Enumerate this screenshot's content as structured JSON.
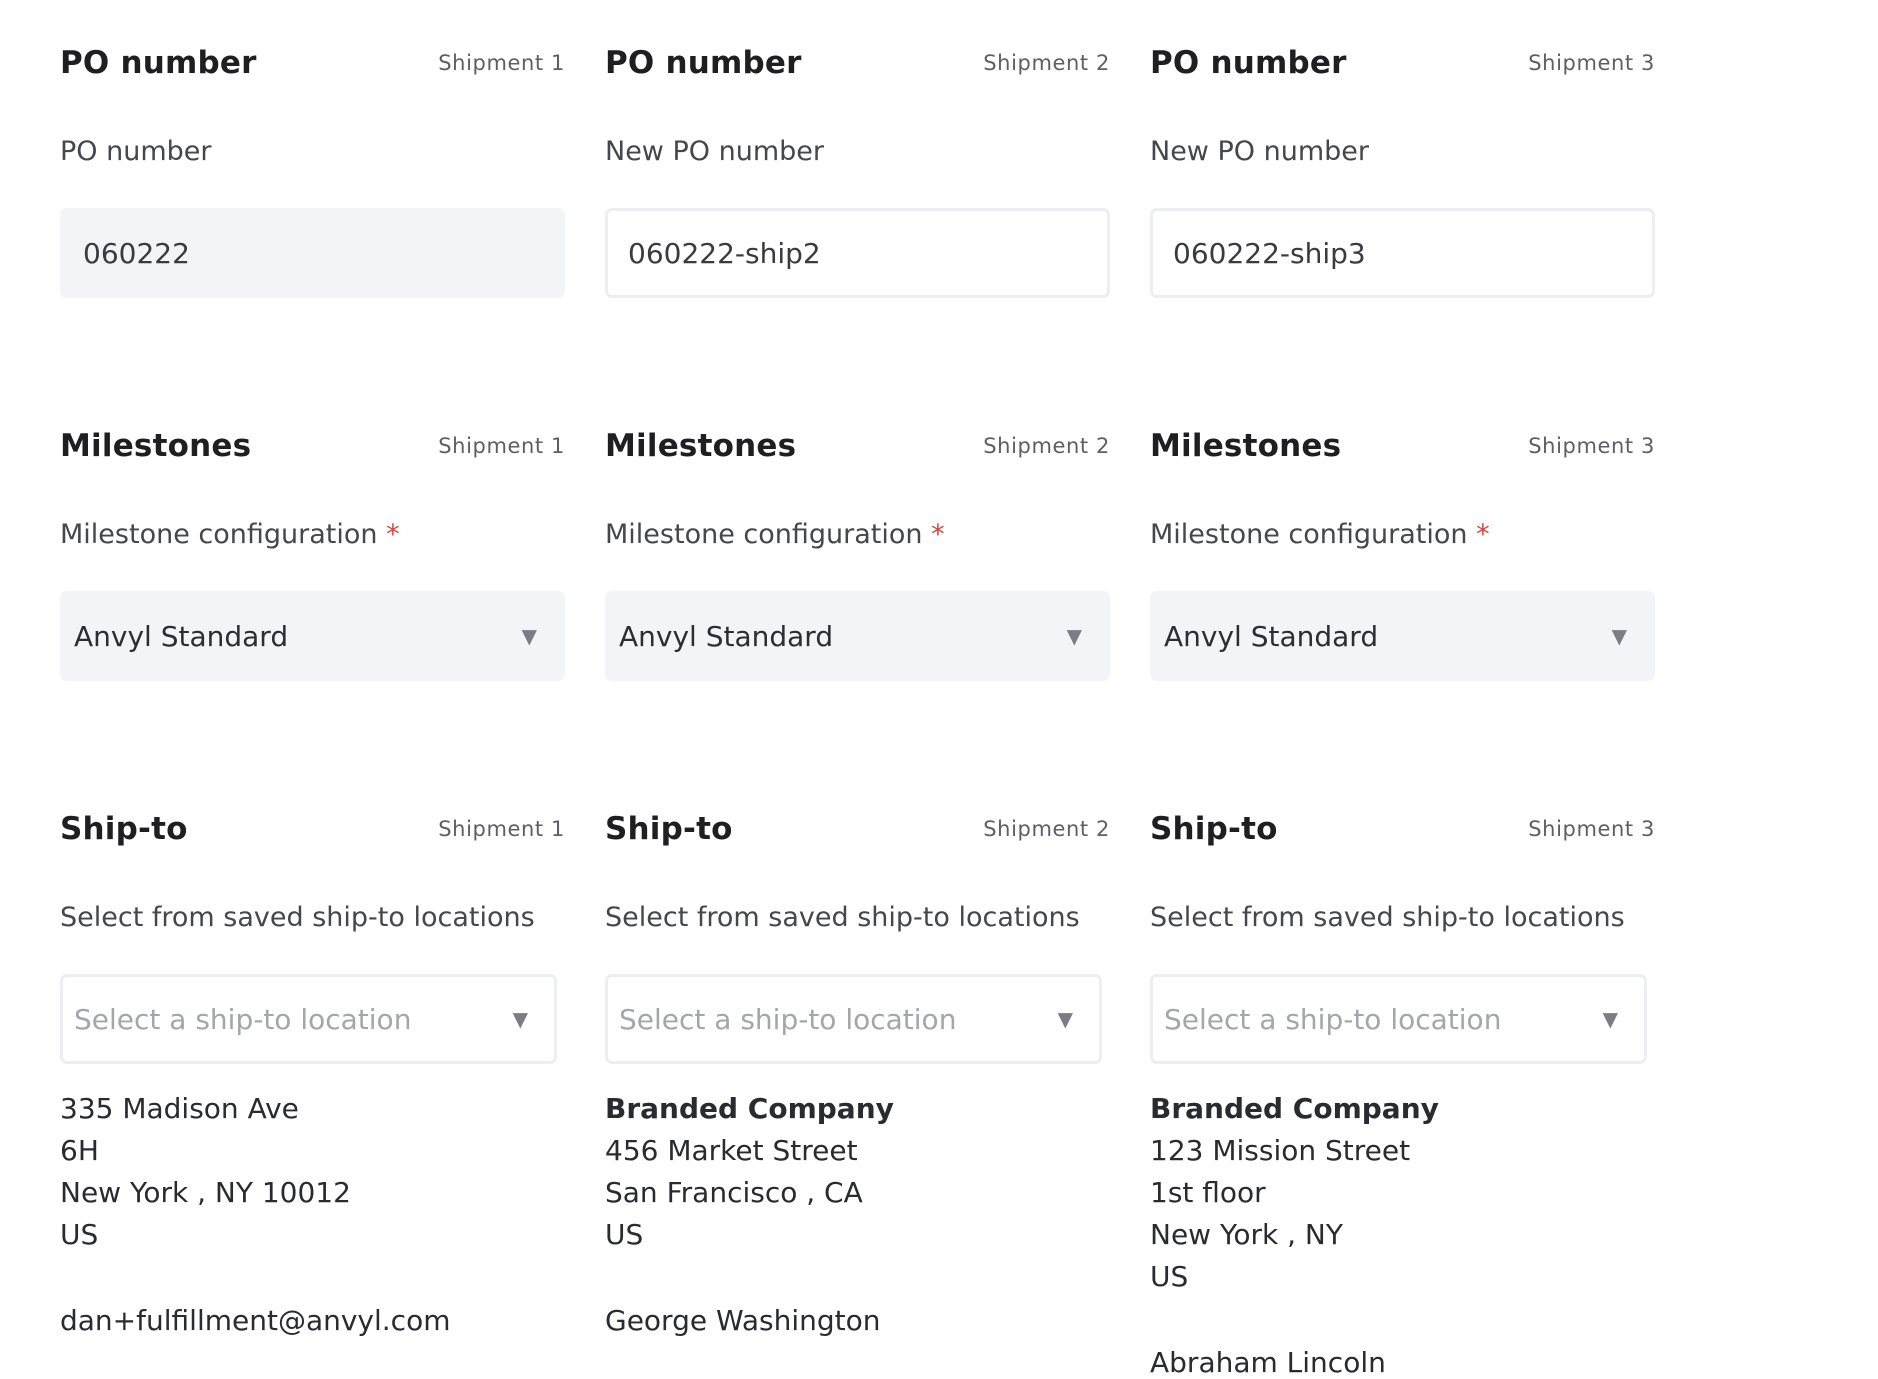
{
  "columns": [
    {
      "shipment_label": "Shipment 1",
      "po_title": "PO number",
      "po_field_label": "PO number",
      "po_value": "060222",
      "milestones_title": "Milestones",
      "milestone_label": "Milestone configuration",
      "milestone_required": "*",
      "milestone_value": "Anvyl Standard",
      "shipto_title": "Ship-to",
      "shipto_label": "Select from saved ship-to locations",
      "shipto_placeholder": "Select a ship-to location",
      "address_lines": [
        "335 Madison Ave",
        "6H",
        "New York , NY 10012",
        "US"
      ],
      "contact": "dan+fulfillment@anvyl.com"
    },
    {
      "shipment_label": "Shipment 2",
      "po_title": "PO number",
      "po_field_label": "New PO number",
      "po_value": "060222-ship2",
      "milestones_title": "Milestones",
      "milestone_label": "Milestone configuration",
      "milestone_required": "*",
      "milestone_value": "Anvyl Standard",
      "shipto_title": "Ship-to",
      "shipto_label": "Select from saved ship-to locations",
      "shipto_placeholder": "Select a ship-to location",
      "company": "Branded Company",
      "address_lines": [
        "456 Market Street",
        "San Francisco , CA",
        "US"
      ],
      "contact": "George Washington"
    },
    {
      "shipment_label": "Shipment 3",
      "po_title": "PO number",
      "po_field_label": "New PO number",
      "po_value": "060222-ship3",
      "milestones_title": "Milestones",
      "milestone_label": "Milestone configuration",
      "milestone_required": "*",
      "milestone_value": "Anvyl Standard",
      "shipto_title": "Ship-to",
      "shipto_label": "Select from saved ship-to locations",
      "shipto_placeholder": "Select a ship-to location",
      "company": "Branded Company",
      "address_lines": [
        "123 Mission Street",
        "1st floor",
        "New York , NY",
        "US"
      ],
      "contact": "Abraham Lincoln"
    }
  ],
  "icons": {
    "dropdown": "caret-down-icon"
  },
  "colors": {
    "required": "#d6453d",
    "field_bg": "#f3f4f7",
    "border": "#eceef2"
  }
}
